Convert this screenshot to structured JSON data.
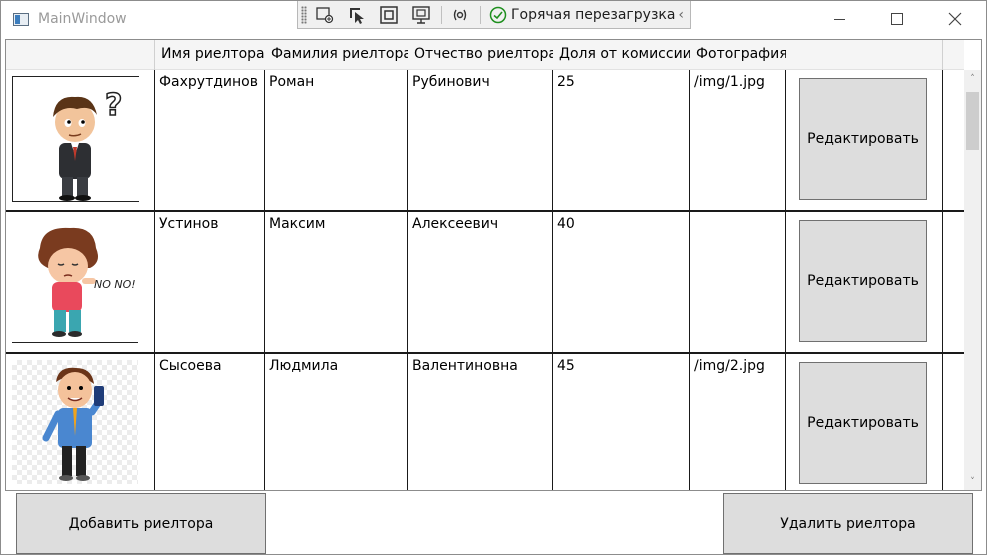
{
  "window": {
    "title": "MainWindow"
  },
  "dev_toolbar": {
    "icons": [
      "select-element-icon",
      "pointer-select-icon",
      "display-layout-adorners-icon",
      "track-focused-element-icon",
      "binding-failures-icon"
    ],
    "hot_reload_label": "Горячая перезагрузка",
    "hot_reload_status_color": "#1e8f1e"
  },
  "table": {
    "columns": [
      {
        "label": ""
      },
      {
        "label": "Имя риелтора"
      },
      {
        "label": "Фамилия риелтора"
      },
      {
        "label": "Отчество риелтора"
      },
      {
        "label": "Доля от комиссии"
      },
      {
        "label": "Фотография"
      },
      {
        "label": ""
      }
    ],
    "edit_label": "Редактировать",
    "rows": [
      {
        "photo": "cartoon-man-thinking",
        "first_name": "Фахрутдинов",
        "last_name": "Роман",
        "patronymic": "Рубинович",
        "commission": "25",
        "photo_path": "/img/1.jpg"
      },
      {
        "photo": "cartoon-boy-no",
        "first_name": "Устинов",
        "last_name": "Максим",
        "patronymic": "Алексеевич",
        "commission": "40",
        "photo_path": ""
      },
      {
        "photo": "cartoon-man-phone",
        "first_name": "Сысоева",
        "last_name": "Людмила",
        "patronymic": "Валентиновна",
        "commission": "45",
        "photo_path": "/img/2.jpg"
      }
    ],
    "photo_text_no": "NO NO!"
  },
  "actions": {
    "add_label": "Добавить риелтора",
    "delete_label": "Удалить риелтора"
  }
}
